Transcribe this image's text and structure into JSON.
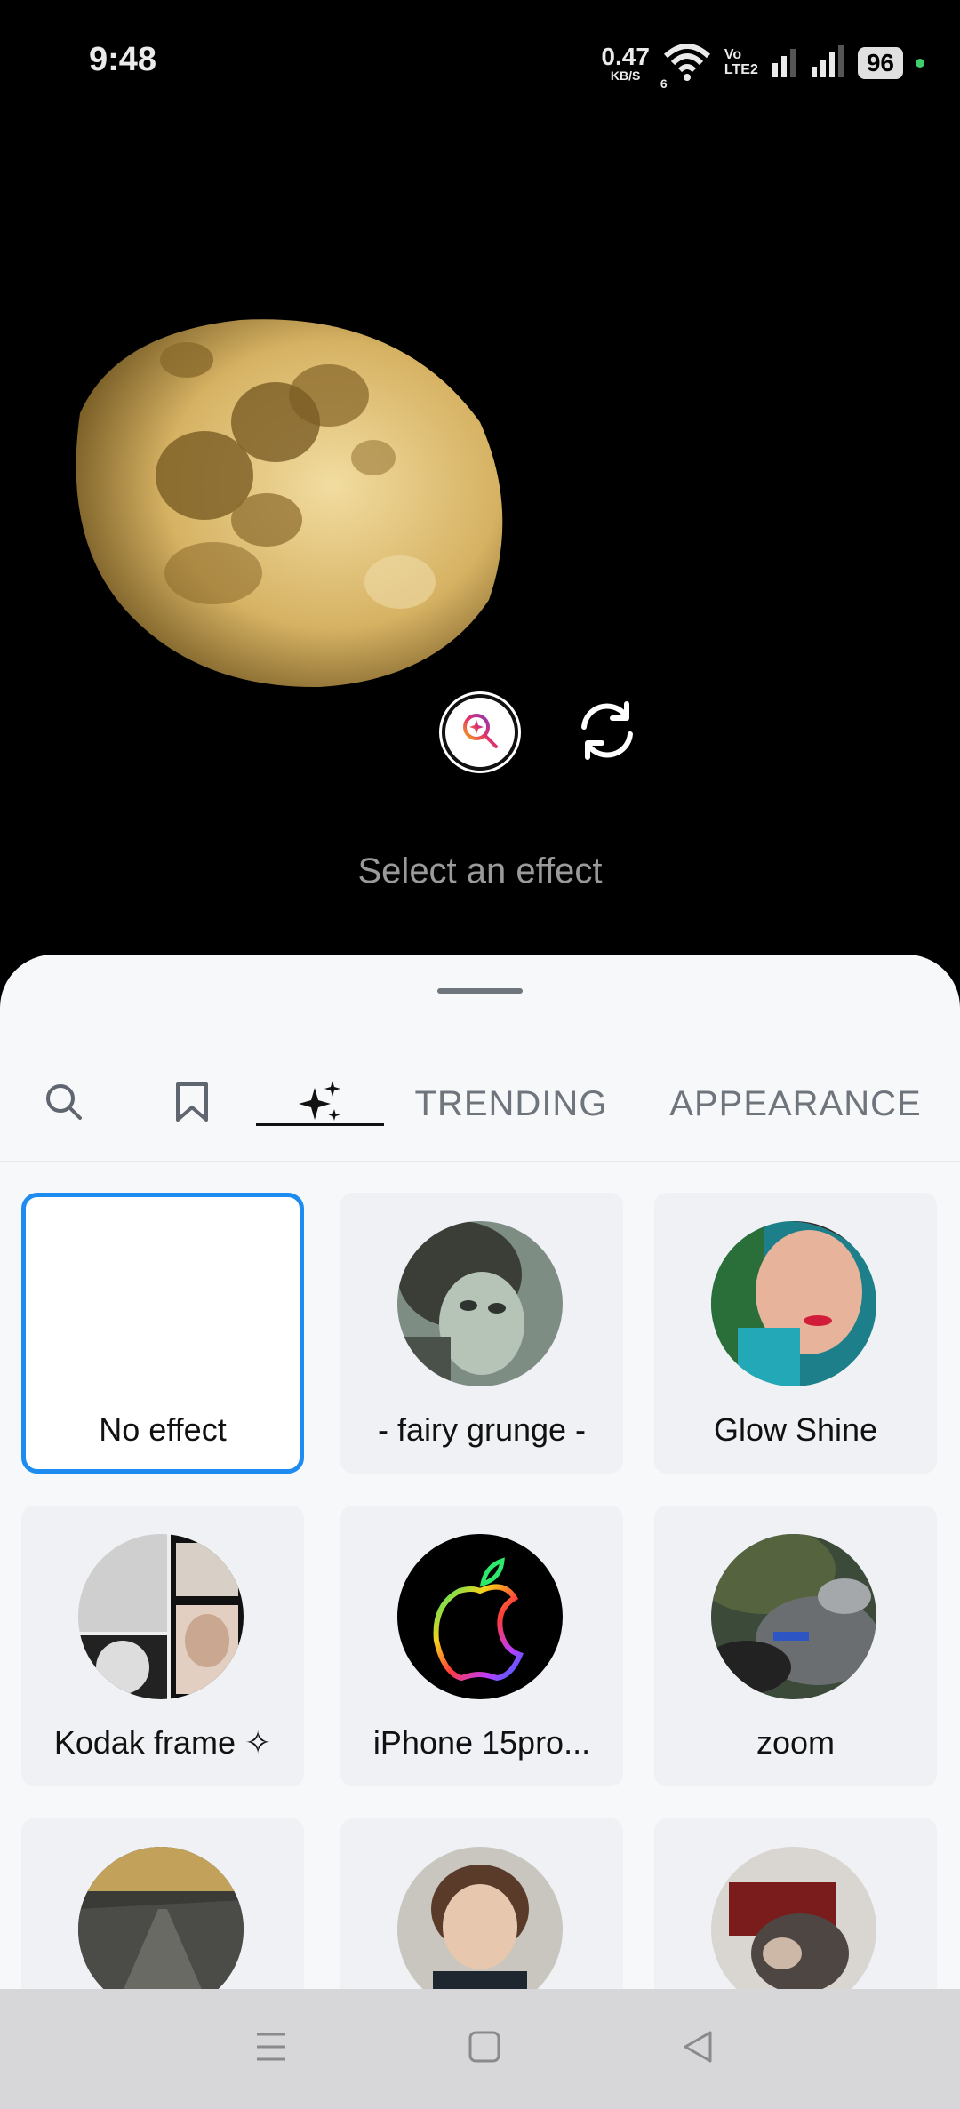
{
  "status_bar": {
    "time": "9:48",
    "net_speed_value": "0.47",
    "net_speed_unit": "KB/S",
    "wifi_badge": "6",
    "volte_top": "Vo",
    "volte_bottom": "LTE2",
    "battery": "96"
  },
  "camera": {
    "hint": "Select an effect"
  },
  "sheet": {
    "tabs": [
      {
        "icon": "search-icon"
      },
      {
        "icon": "bookmark-icon"
      },
      {
        "icon": "sparkles-icon",
        "selected": true
      },
      {
        "label": "TRENDING"
      },
      {
        "label": "APPEARANCE"
      }
    ],
    "effects": [
      {
        "label": "No effect",
        "selected": true
      },
      {
        "label": "- fairy grunge -"
      },
      {
        "label": "Glow Shine"
      },
      {
        "label": "Kodak frame ✧"
      },
      {
        "label": "iPhone 15pro..."
      },
      {
        "label": "zoom"
      },
      {
        "label": ""
      },
      {
        "label": ""
      },
      {
        "label": ""
      }
    ]
  },
  "colors": {
    "accent": "#1d8bf0",
    "sheet_bg": "#f7f8fa",
    "card_bg": "#eff1f4"
  }
}
